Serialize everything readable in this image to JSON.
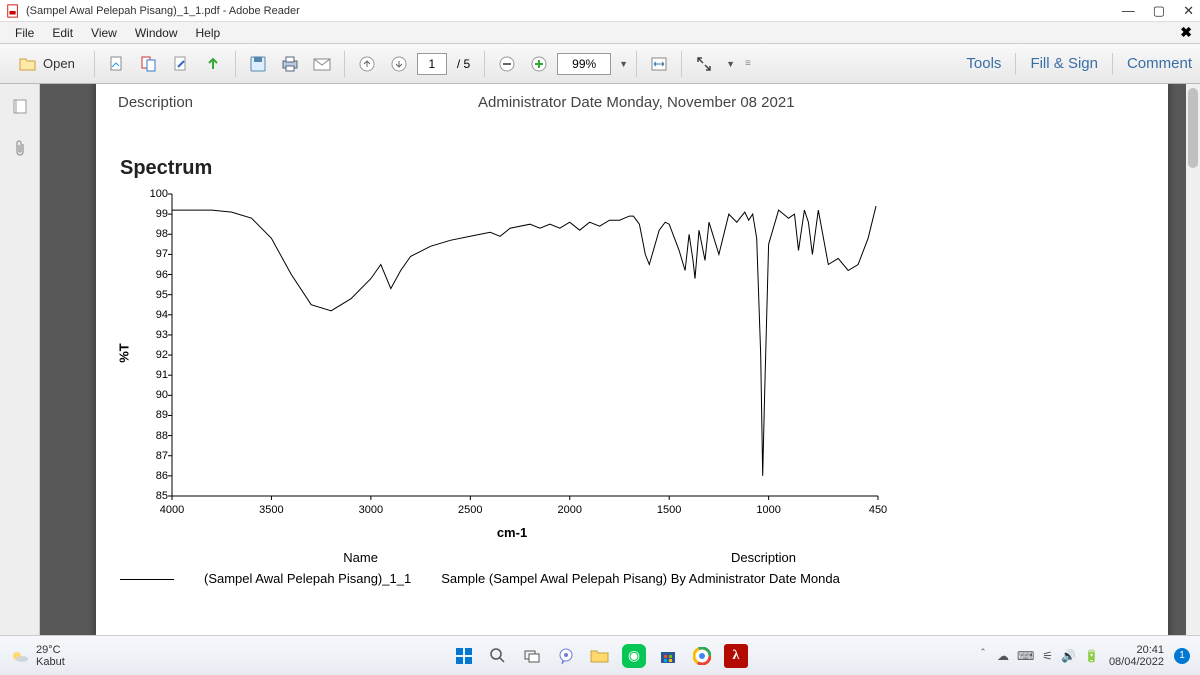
{
  "titlebar": {
    "title": "(Sampel Awal Pelepah Pisang)_1_1.pdf - Adobe Reader"
  },
  "menu": {
    "items": [
      "File",
      "Edit",
      "View",
      "Window",
      "Help"
    ]
  },
  "toolbar": {
    "open_label": "Open",
    "page_current": "1",
    "page_total": "/ 5",
    "zoom": "99%",
    "tools": "Tools",
    "fill_sign": "Fill & Sign",
    "comment": "Comment"
  },
  "document": {
    "header_left": "Description",
    "header_right": "Administrator Date Monday, November 08 2021",
    "spectrum_title": "Spectrum",
    "legend": {
      "col1": "Name",
      "col2": "Description",
      "name": "(Sampel Awal Pelepah Pisang)_1_1",
      "desc": "Sample (Sampel Awal Pelepah Pisang) By Administrator Date Monda"
    }
  },
  "chart_data": {
    "type": "line",
    "title": "Spectrum",
    "xlabel": "cm-1",
    "ylabel": "%T",
    "xlim": [
      4000,
      450
    ],
    "ylim": [
      85,
      100
    ],
    "xticks": [
      4000,
      3500,
      3000,
      2500,
      2000,
      1500,
      1000,
      450
    ],
    "yticks": [
      85,
      86,
      87,
      88,
      89,
      90,
      91,
      92,
      93,
      94,
      95,
      96,
      97,
      98,
      99,
      100
    ],
    "series": [
      {
        "name": "(Sampel Awal Pelepah Pisang)_1_1",
        "x": [
          4000,
          3900,
          3800,
          3700,
          3600,
          3500,
          3400,
          3300,
          3200,
          3100,
          3000,
          2950,
          2900,
          2850,
          2800,
          2700,
          2600,
          2500,
          2400,
          2350,
          2300,
          2200,
          2150,
          2100,
          2050,
          2000,
          1950,
          1900,
          1850,
          1800,
          1750,
          1700,
          1680,
          1650,
          1620,
          1600,
          1550,
          1520,
          1500,
          1450,
          1420,
          1400,
          1380,
          1370,
          1350,
          1320,
          1300,
          1250,
          1200,
          1160,
          1120,
          1100,
          1080,
          1060,
          1040,
          1030,
          1020,
          1000,
          950,
          900,
          870,
          850,
          820,
          800,
          780,
          750,
          700,
          650,
          600,
          550,
          500,
          460
        ],
        "y": [
          99.2,
          99.2,
          99.2,
          99.1,
          98.8,
          97.8,
          96.0,
          94.5,
          94.2,
          94.8,
          95.8,
          96.5,
          95.3,
          96.2,
          96.9,
          97.4,
          97.7,
          97.9,
          98.1,
          97.9,
          98.3,
          98.5,
          98.3,
          98.5,
          98.3,
          98.6,
          98.2,
          98.6,
          98.4,
          98.7,
          98.7,
          98.9,
          98.9,
          98.5,
          97.0,
          96.5,
          98.2,
          98.6,
          98.5,
          97.2,
          96.2,
          98.0,
          96.7,
          95.8,
          98.2,
          96.7,
          98.6,
          97.0,
          99.0,
          98.6,
          99.1,
          98.7,
          99.0,
          97.8,
          92.0,
          86.0,
          90.0,
          97.5,
          99.2,
          98.8,
          99.0,
          97.2,
          99.2,
          98.6,
          97.0,
          99.2,
          96.5,
          96.8,
          96.2,
          96.5,
          97.8,
          99.4
        ]
      }
    ]
  },
  "taskbar": {
    "temp": "29°C",
    "weather": "Kabut",
    "time": "20:41",
    "date": "08/04/2022",
    "notif_count": "1"
  }
}
